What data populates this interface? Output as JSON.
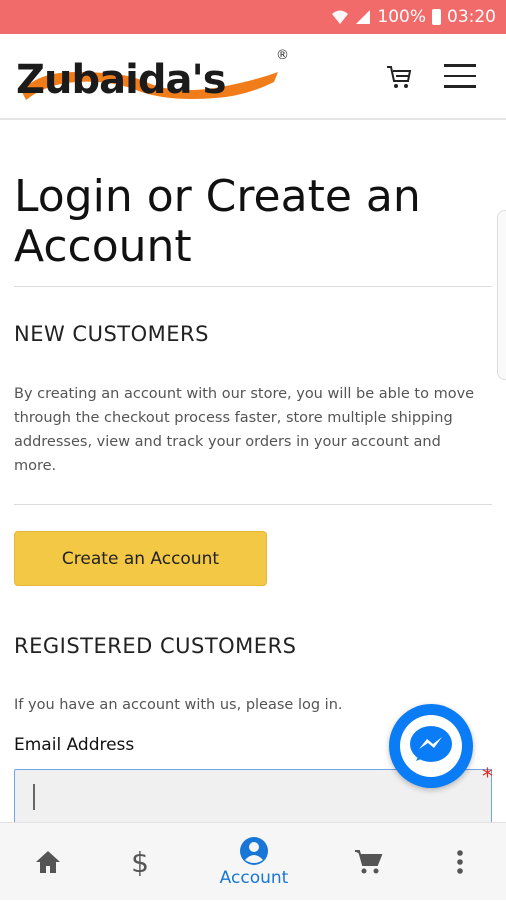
{
  "status_bar": {
    "battery": "100%",
    "time": "03:20"
  },
  "header": {
    "logo_text": "Zubaida's",
    "logo_mark": "®"
  },
  "page": {
    "title": "Login or Create an Account",
    "new_customers": {
      "heading": "NEW CUSTOMERS",
      "description": "By creating an account with our store, you will be able to move through the checkout process faster, store multiple shipping addresses, view and track your orders in your account and more.",
      "button_label": "Create an Account"
    },
    "registered_customers": {
      "heading": "REGISTERED CUSTOMERS",
      "prompt": "If you have an account with us, please log in.",
      "email_label": "Email Address",
      "email_value": "",
      "required_mark": "*"
    }
  },
  "bottom_nav": {
    "items": [
      {
        "icon": "home-icon",
        "label": ""
      },
      {
        "icon": "dollar-icon",
        "label": ""
      },
      {
        "icon": "account-icon",
        "label": "Account",
        "active": true
      },
      {
        "icon": "cart-icon",
        "label": ""
      },
      {
        "icon": "more-vertical-icon",
        "label": ""
      }
    ]
  },
  "colors": {
    "status_bar": "#f26b6b",
    "logo_orange": "#f07d1a",
    "primary_button": "#f3c844",
    "accent_blue": "#1877d6",
    "messenger": "#0a7cf5"
  }
}
